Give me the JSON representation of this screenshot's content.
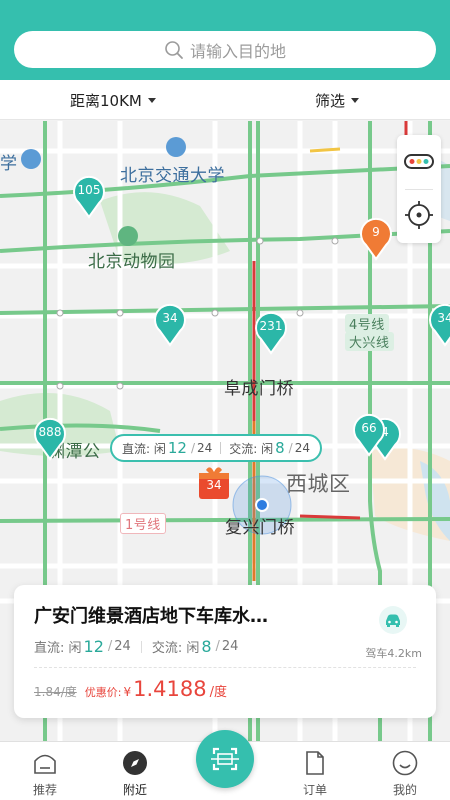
{
  "search": {
    "placeholder": "请输入目的地"
  },
  "filters": {
    "distance": "距离10KM",
    "filter": "筛选"
  },
  "map": {
    "labels": {
      "school_prefix": "学",
      "university": "北京交通大学",
      "zoo": "北京动物园",
      "fuchengmen": "阜成门桥",
      "yuyuantan": "渊潭公",
      "xicheng": "西城区",
      "fuxingmen": "复兴门桥",
      "line1": "1号线",
      "line4_a": "4号线",
      "line4_b": "大兴线"
    },
    "pins": [
      "105",
      "9",
      "34",
      "231",
      "34",
      "888",
      "66",
      "4"
    ],
    "gift_count": "34",
    "bubble": {
      "direct_label": "直流: 闲",
      "direct_free": "12",
      "direct_total": "24",
      "ac_label": "交流: 闲",
      "ac_free": "8",
      "ac_total": "24"
    }
  },
  "station": {
    "name": "广安门维景酒店地下车库水…",
    "direct_label": "直流: 闲",
    "direct_free": "12",
    "direct_total": "24",
    "ac_label": "交流: 闲",
    "ac_free": "8",
    "ac_total": "24",
    "slash": "/",
    "original_price": "1.84/度",
    "price_label": "优惠价:",
    "currency": "¥",
    "price": "1.4188",
    "unit": "/度",
    "distance": "驾车4.2km"
  },
  "nav": {
    "items": [
      "推荐",
      "附近",
      "订单",
      "我的"
    ],
    "active": "附近"
  },
  "colors": {
    "brand": "#35bfae",
    "price": "#e8453c",
    "pin": "#2bb7a8",
    "pin_alert": "#f07b35"
  }
}
